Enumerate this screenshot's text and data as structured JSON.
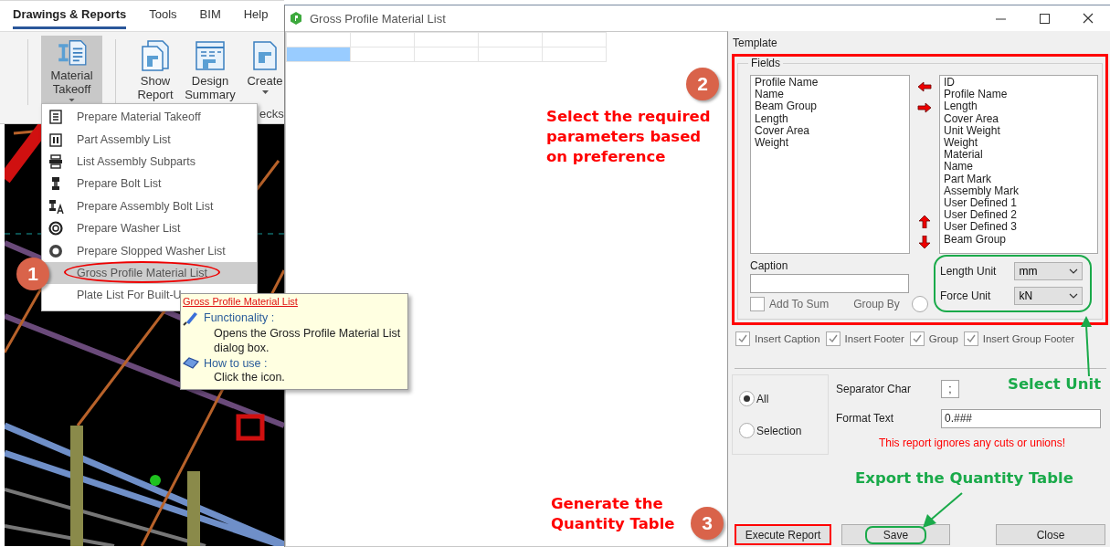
{
  "app": {
    "ribbon_tabs": [
      {
        "label": "Drawings & Reports",
        "selected": true
      },
      {
        "label": "Tools",
        "selected": false
      },
      {
        "label": "BIM",
        "selected": false
      },
      {
        "label": "Help",
        "selected": false
      }
    ],
    "ribbon_buttons": [
      {
        "label": "Material Takeoff",
        "selected": true,
        "dropdown": true
      },
      {
        "label": "Show Report",
        "selected": false,
        "dropdown": false
      },
      {
        "label": "Design Summary",
        "selected": false,
        "dropdown": false
      },
      {
        "label": "Create",
        "selected": false,
        "dropdown": true
      }
    ],
    "group_labels": [
      "ecks"
    ],
    "viewport": {
      "kind": "picture"
    }
  },
  "menu": {
    "items": [
      {
        "label": "Prepare Material Takeoff",
        "selected": false
      },
      {
        "label": "Part Assembly List",
        "selected": false
      },
      {
        "label": "List Assembly Subparts",
        "selected": false
      },
      {
        "label": "Prepare Bolt List",
        "selected": false
      },
      {
        "label": "Prepare Assembly Bolt List",
        "selected": false
      },
      {
        "label": "Prepare Washer List",
        "selected": false
      },
      {
        "label": "Prepare Slopped Washer List",
        "selected": false
      },
      {
        "label": "Gross Profile Material List",
        "selected": true
      },
      {
        "label": "Plate List For Built-U",
        "selected": false
      }
    ]
  },
  "tooltip": {
    "title": "Gross Profile Material List",
    "sections": [
      {
        "heading": "Functionality :",
        "text": "Opens the Gross Profile Material List dialog box."
      },
      {
        "heading": "How to use :",
        "text": "Click the icon."
      }
    ]
  },
  "dialog": {
    "title": "Gross Profile Material List",
    "grid": {
      "rows": [
        {
          "cells": [
            {
              "selected": false
            },
            {
              "selected": false
            },
            {
              "selected": false
            },
            {
              "selected": false
            },
            {
              "selected": false
            }
          ]
        },
        {
          "cells": [
            {
              "selected": true
            },
            {
              "selected": false
            },
            {
              "selected": false
            },
            {
              "selected": false
            },
            {
              "selected": false
            }
          ]
        }
      ]
    },
    "template_label": "Template",
    "fields_label": "Fields",
    "available_fields": [
      "Profile Name",
      "Name",
      "Beam Group",
      "Length",
      "Cover Area",
      "Weight"
    ],
    "report_fields": [
      "ID",
      "Profile Name",
      "Length",
      "Cover Area",
      "Unit Weight",
      "Weight",
      "Material",
      "Name",
      "Part Mark",
      "Assembly Mark",
      "User Defined 1",
      "User Defined 2",
      "User Defined 3",
      "Beam Group"
    ],
    "caption": {
      "label": "Caption"
    },
    "add_to_sum": {
      "label": "Add To Sum",
      "checked": false
    },
    "group_by": {
      "label": "Group By",
      "selected": false
    },
    "units": [
      {
        "label": "Length Unit",
        "value": "mm"
      },
      {
        "label": "Force Unit",
        "value": "kN"
      }
    ],
    "options": [
      {
        "label": "Insert Caption",
        "checked": true
      },
      {
        "label": "Insert Footer",
        "checked": true
      },
      {
        "label": "Group",
        "checked": true
      },
      {
        "label": "Insert Group Footer",
        "checked": true
      }
    ],
    "scope": [
      {
        "label": "All",
        "selected": true
      },
      {
        "label": "Selection",
        "selected": false
      }
    ],
    "separator": {
      "label": "Separator Char",
      "value": ";"
    },
    "format": {
      "label": "Format Text",
      "value": "0.###"
    },
    "warning": "This report ignores any cuts or unions!",
    "buttons": [
      {
        "label": "Execute Report",
        "kind": "boxed",
        "color": "#ff0000"
      },
      {
        "label": "Save",
        "kind": "ringed",
        "color": "#1aaa4a"
      },
      {
        "label": "Close",
        "kind": "plain"
      }
    ]
  },
  "annotations": {
    "steps": [
      {
        "number": "1"
      },
      {
        "number": "2"
      },
      {
        "number": "3"
      }
    ],
    "callouts": [
      {
        "text": "Select the required parameters based on preference",
        "color": "#ff0000"
      },
      {
        "text": "Generate the Quantity Table",
        "color": "#ff0000"
      },
      {
        "text": "Select Unit",
        "color": "#1aaa4a"
      },
      {
        "text": "Export the Quantity Table",
        "color": "#1aaa4a"
      }
    ]
  }
}
